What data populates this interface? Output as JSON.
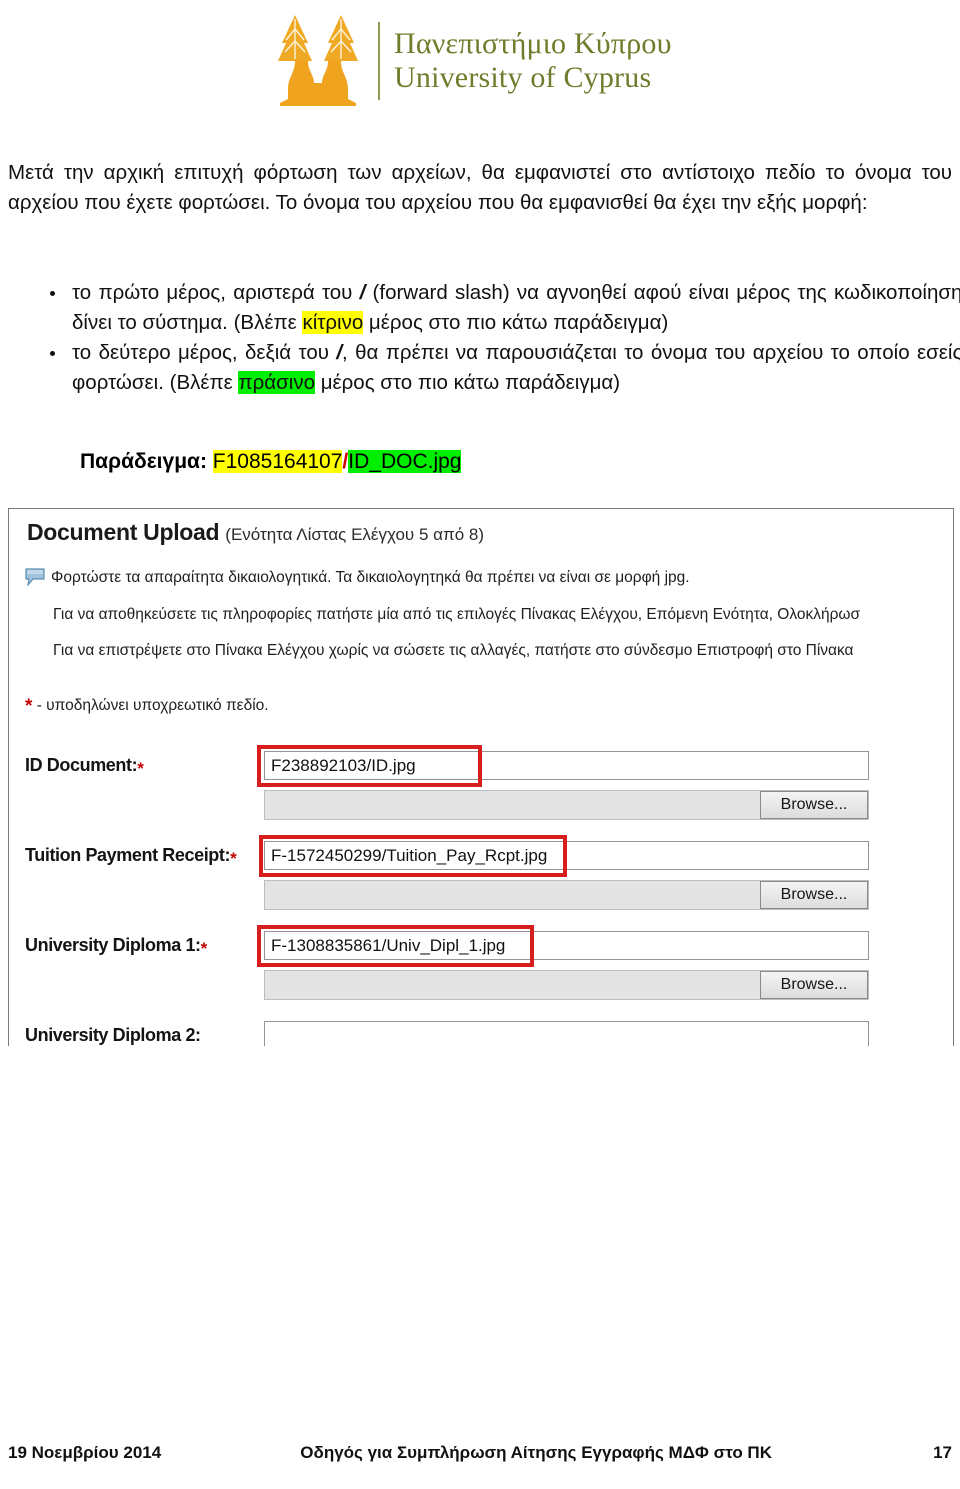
{
  "logo": {
    "greek": "Πανεπιστήμιο Κύπρου",
    "english": "University of Cyprus",
    "mark_color": "#f0a924",
    "text_color": "#6e7d2b"
  },
  "intro": {
    "paragraph": "Μετά την αρχική επιτυχή φόρτωση των αρχείων, θα εμφανιστεί στο αντίστοιχο πεδίο το όνομα του αρχείου που έχετε φορτώσει. Το όνομα του αρχείου που θα εμφανισθεί θα έχει την εξής μορφή:"
  },
  "bullets": [
    {
      "part1": "το πρώτο μέρος, αριστερά του ",
      "slash": "/",
      "part2": " (forward slash) να αγνοηθεί αφού είναι μέρος της κωδικοποίησης που δίνει το σύστημα. (Βλέπε ",
      "highlight": "κίτρινο",
      "highlight_color": "#ffff00",
      "part3": " μέρος στο πιο κάτω παράδειγμα)"
    },
    {
      "part1": "το δεύτερο μέρος, δεξιά του ",
      "slash": "/",
      "part2": ", θα πρέπει να παρουσιάζεται το όνομα του αρχείου το οποίο εσείς έχετε φορτώσει. (Βλέπε ",
      "highlight": "πράσινο",
      "highlight_color": "#00ee00",
      "part3": " μέρος στο πιο κάτω παράδειγμα)"
    }
  ],
  "example": {
    "label": "Παράδειγμα:",
    "code_yellow": "F1085164107",
    "slash": "/",
    "code_green": "ID_DOC.jpg",
    "yellow": "#ffff00",
    "green": "#00ee00",
    "slash_color": "#d00000"
  },
  "screenshot": {
    "title": "Document Upload",
    "subtitle": "(Ενότητα Λίστας Ελέγχου 5 από 8)",
    "note_icon": "comment-bubble-icon",
    "line1": "Φορτώστε τα απαραίτητα δικαιολογητικά. Τα δικαιολογητηκά θα πρέπει να είναι σε μορφή jpg.",
    "line2": "Για να αποθηκεύσετε τις πληροφορίες πατήστε μία από τις επιλογές Πίνακας Ελέγχου, Επόμενη Ενότητα, Ολοκλήρωσ",
    "line3": "Για να επιστρέψετε στο Πίνακα Ελέγχου χωρίς να σώσετε τις αλλαγές, πατήστε στο σύνδεσμο Επιστροφή στο Πίνακα",
    "required_star": "*",
    "required_legend": "- υποδηλώνει υποχρεωτικό πεδίο.",
    "browse_label": "Browse...",
    "fields": [
      {
        "label": "ID Document:",
        "required": "*",
        "value": "F238892103/ID.jpg",
        "highlighted": true,
        "has_browse": true
      },
      {
        "label": "Tuition Payment Receipt:",
        "required": "*",
        "value": "F-1572450299/Tuition_Pay_Rcpt.jpg",
        "highlighted": true,
        "has_browse": true
      },
      {
        "label": "University Diploma 1:",
        "required": "*",
        "value": "F-1308835861/Univ_Dipl_1.jpg",
        "highlighted": true,
        "has_browse": true
      },
      {
        "label": "University Diploma 2:",
        "required": "",
        "value": "",
        "highlighted": false,
        "has_browse": false
      }
    ]
  },
  "footer": {
    "date": "19 Νοεμβρίου 2014",
    "center": "Οδηγός  για Συμπλήρωση Αίτησης Εγγραφής ΜΔΦ στο ΠΚ",
    "page": "17"
  }
}
